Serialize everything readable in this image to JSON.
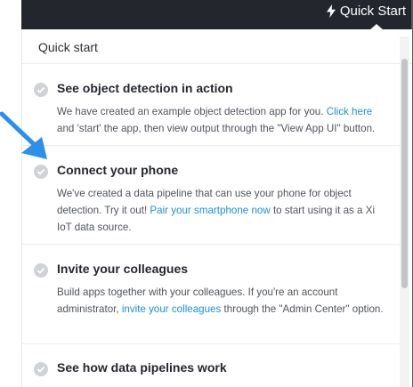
{
  "header": {
    "quick_start_label": "Quick Start",
    "quick_start_icon": "lightning-bolt-icon"
  },
  "panel": {
    "title": "Quick start",
    "items": [
      {
        "title": "See object detection in action",
        "desc_before": "We have created an example object detection app for you. ",
        "link": "Click here",
        "desc_after": " and 'start' the app, then view output through the \"View App UI\" button.",
        "completed": true
      },
      {
        "title": "Connect your phone",
        "desc_before": "We've created a data pipeline that can use your phone for object detection. Try it out! ",
        "link": "Pair your smartphone now",
        "desc_after": " to start using it as a Xi IoT data source.",
        "completed": true
      },
      {
        "title": "Invite your colleagues",
        "desc_before": "Build apps together with your colleagues. If you're an account administrator, ",
        "link": "invite your colleagues",
        "desc_after": " through the \"Admin Center\" option.",
        "completed": true
      },
      {
        "title": "See how data pipelines work",
        "completed": true
      }
    ]
  },
  "colors": {
    "header_bg": "#23262d",
    "link": "#1f8ed6",
    "check": "#cfd2d6",
    "pointer_arrow": "#2c8fe8"
  }
}
